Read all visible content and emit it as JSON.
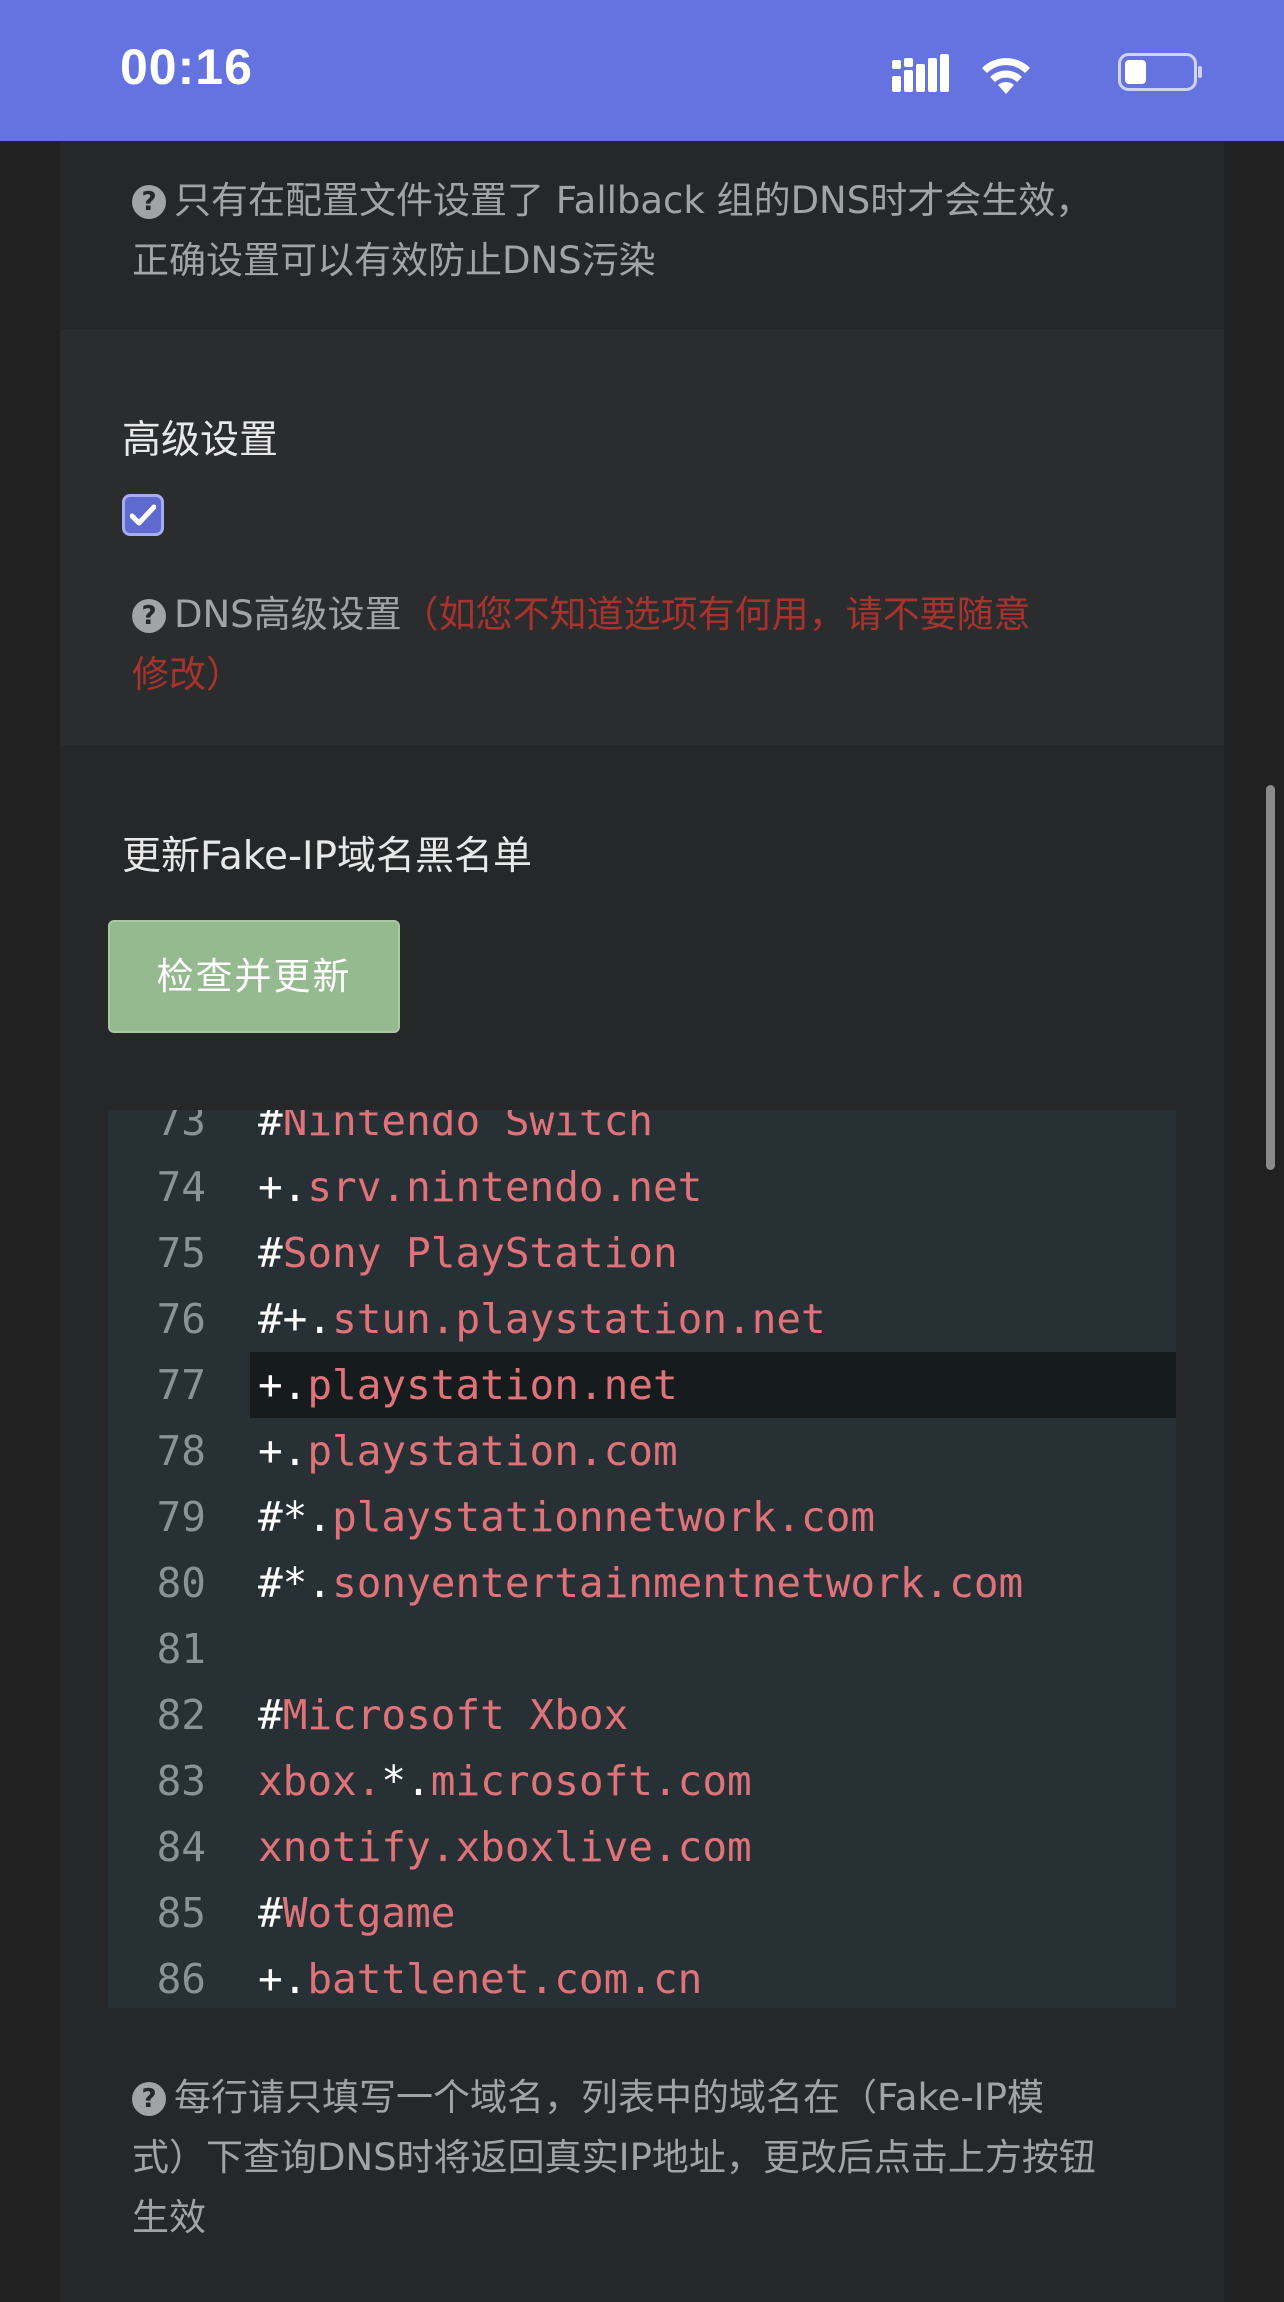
{
  "status_bar": {
    "time": "00:16"
  },
  "fallback_hint": {
    "line1": "只有在配置文件设置了 Fallback 组的DNS时才会生效，",
    "line2": "正确设置可以有效防止DNS污染"
  },
  "advanced": {
    "title": "高级设置",
    "checked": true,
    "hint_text": "DNS高级设置",
    "hint_warn_1": "（如您不知道选项有何用，请不要随意",
    "hint_warn_2": "修改）"
  },
  "fakeip": {
    "title": "更新Fake-IP域名黑名单",
    "button_label": "检查并更新"
  },
  "editor": {
    "active_line": 77,
    "lines": [
      {
        "n": "73",
        "p": "#",
        "d": "Nintendo Switch"
      },
      {
        "n": "74",
        "p": "+.",
        "d": "srv.nintendo.net"
      },
      {
        "n": "75",
        "p": "#",
        "d": "Sony PlayStation"
      },
      {
        "n": "76",
        "p": "#+.",
        "d": "stun.playstation.net"
      },
      {
        "n": "77",
        "p": "+.",
        "d": "playstation.net"
      },
      {
        "n": "78",
        "p": "+.",
        "d": "playstation.com"
      },
      {
        "n": "79",
        "p": "#*.",
        "d": "playstationnetwork.com"
      },
      {
        "n": "80",
        "p": "#*.",
        "d": "sonyentertainmentnetwork.com"
      },
      {
        "n": "81",
        "p": "",
        "d": ""
      },
      {
        "n": "82",
        "p": "#",
        "d": "Microsoft Xbox"
      },
      {
        "n": "83",
        "p": "",
        "d": "xbox.",
        "p2": "*.",
        "d2": "microsoft.com"
      },
      {
        "n": "84",
        "p": "",
        "d": "xnotify.xboxlive.com"
      },
      {
        "n": "85",
        "p": "#",
        "d": "Wotgame"
      },
      {
        "n": "86",
        "p": "+.",
        "d": "battlenet.com.cn"
      }
    ]
  },
  "domain_hint": {
    "line1": "每行请只填写一个域名，列表中的域名在（Fake-IP模",
    "line2": "式）下查询DNS时将返回真实IP地址，更改后点击上方按钮",
    "line3": "生效"
  }
}
